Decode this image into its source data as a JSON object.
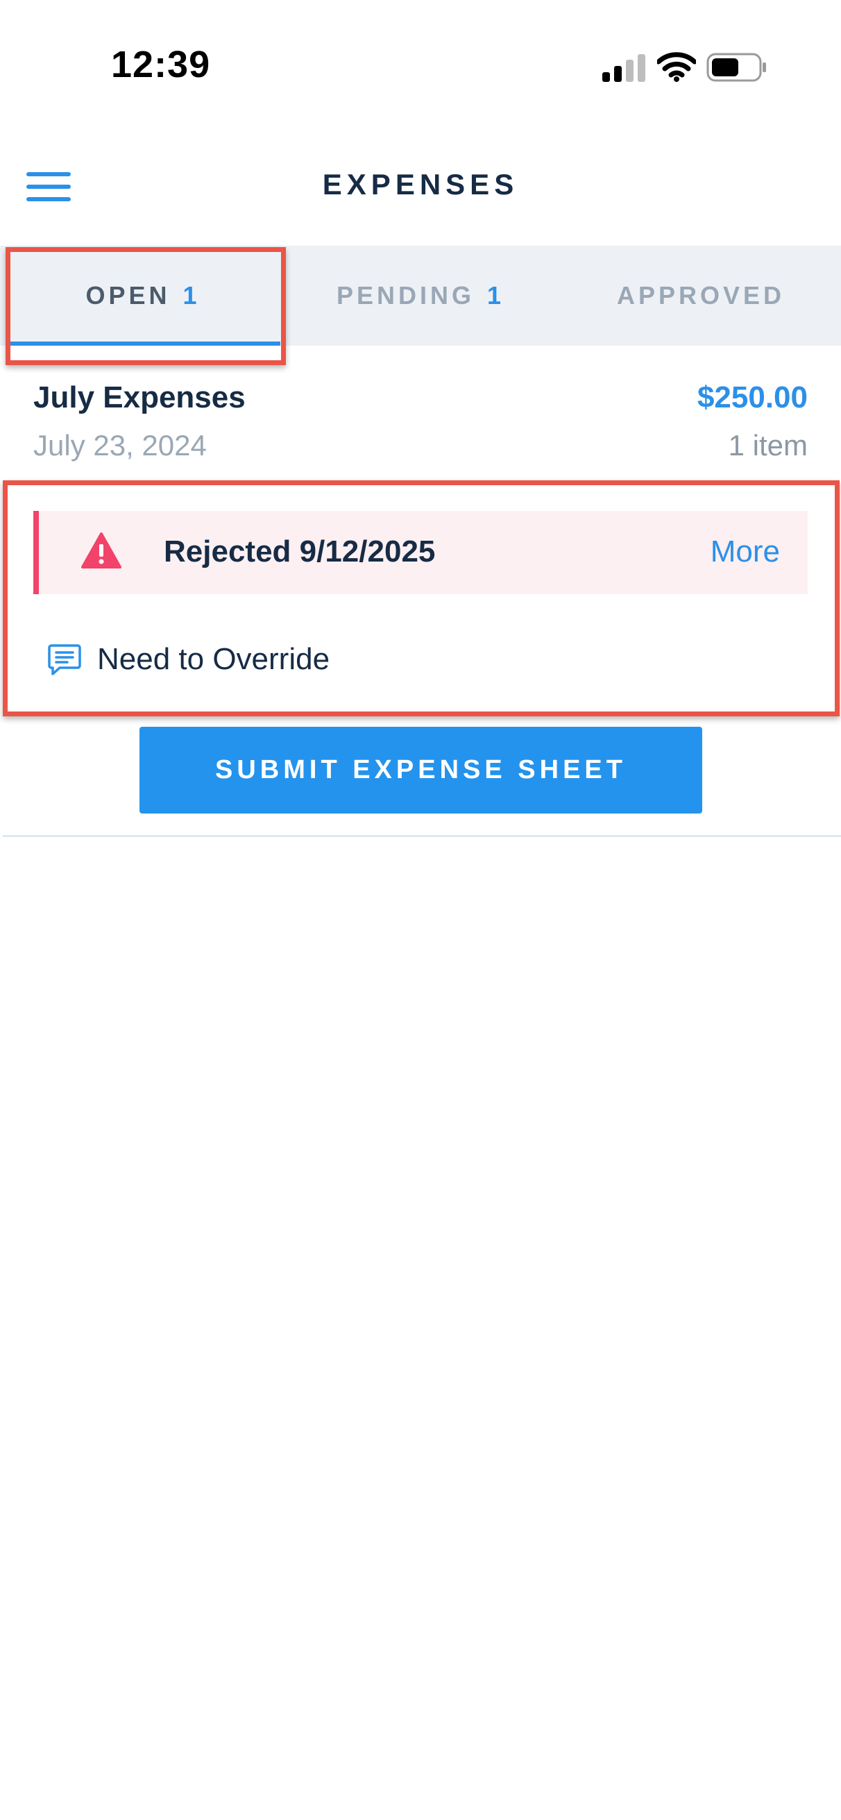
{
  "status_bar": {
    "time": "12:39"
  },
  "header": {
    "title": "EXPENSES"
  },
  "tabs": [
    {
      "label": "OPEN",
      "count": "1",
      "active": true
    },
    {
      "label": "PENDING",
      "count": "1",
      "active": false
    },
    {
      "label": "APPROVED",
      "count": "",
      "active": false
    }
  ],
  "expense_sheet": {
    "name": "July Expenses",
    "amount": "$250.00",
    "date": "July 23, 2024",
    "item_count": "1 item",
    "rejection": {
      "text": "Rejected 9/12/2025",
      "more_label": "More"
    },
    "comment": "Need to Override"
  },
  "actions": {
    "submit_label": "SUBMIT EXPENSE SHEET"
  },
  "icons": {
    "menu": "hamburger-menu-icon",
    "warning": "warning-triangle-icon",
    "comment": "chat-bubble-icon",
    "signal": "cellular-signal-icon",
    "wifi": "wifi-icon",
    "battery": "battery-icon"
  },
  "colors": {
    "accent": "#2b90e8",
    "button": "#2393ee",
    "danger": "#f2436a",
    "notice_bg": "#fdf0f2",
    "tabs_bg": "#edf1f5",
    "annotation": "#ea5547"
  }
}
